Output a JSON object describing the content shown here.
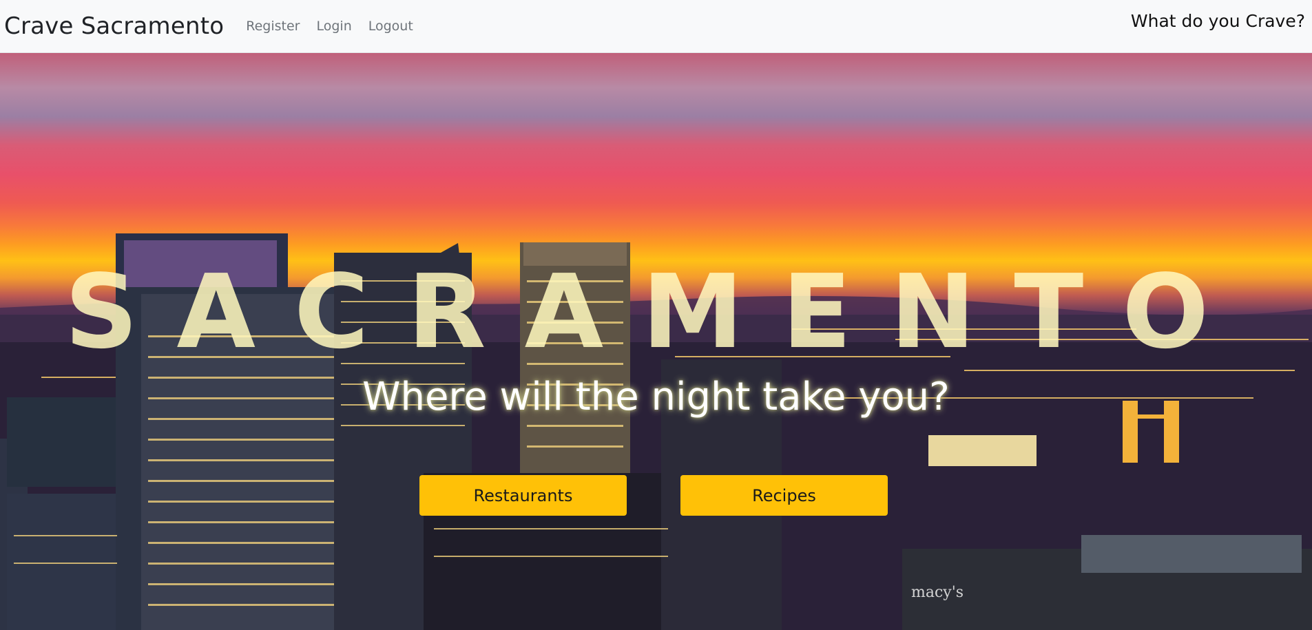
{
  "navbar": {
    "brand": "Crave Sacramento",
    "links": [
      "Register",
      "Login",
      "Logout"
    ],
    "right_text": "What do you Crave?"
  },
  "hero": {
    "title": "SACRAMENTO",
    "tagline": "Where will the night take you?",
    "buttons": [
      "Restaurants",
      "Recipes"
    ],
    "billboard": "macy's"
  },
  "colors": {
    "button_bg": "#ffc107",
    "navbar_bg": "#f8f9fa"
  }
}
